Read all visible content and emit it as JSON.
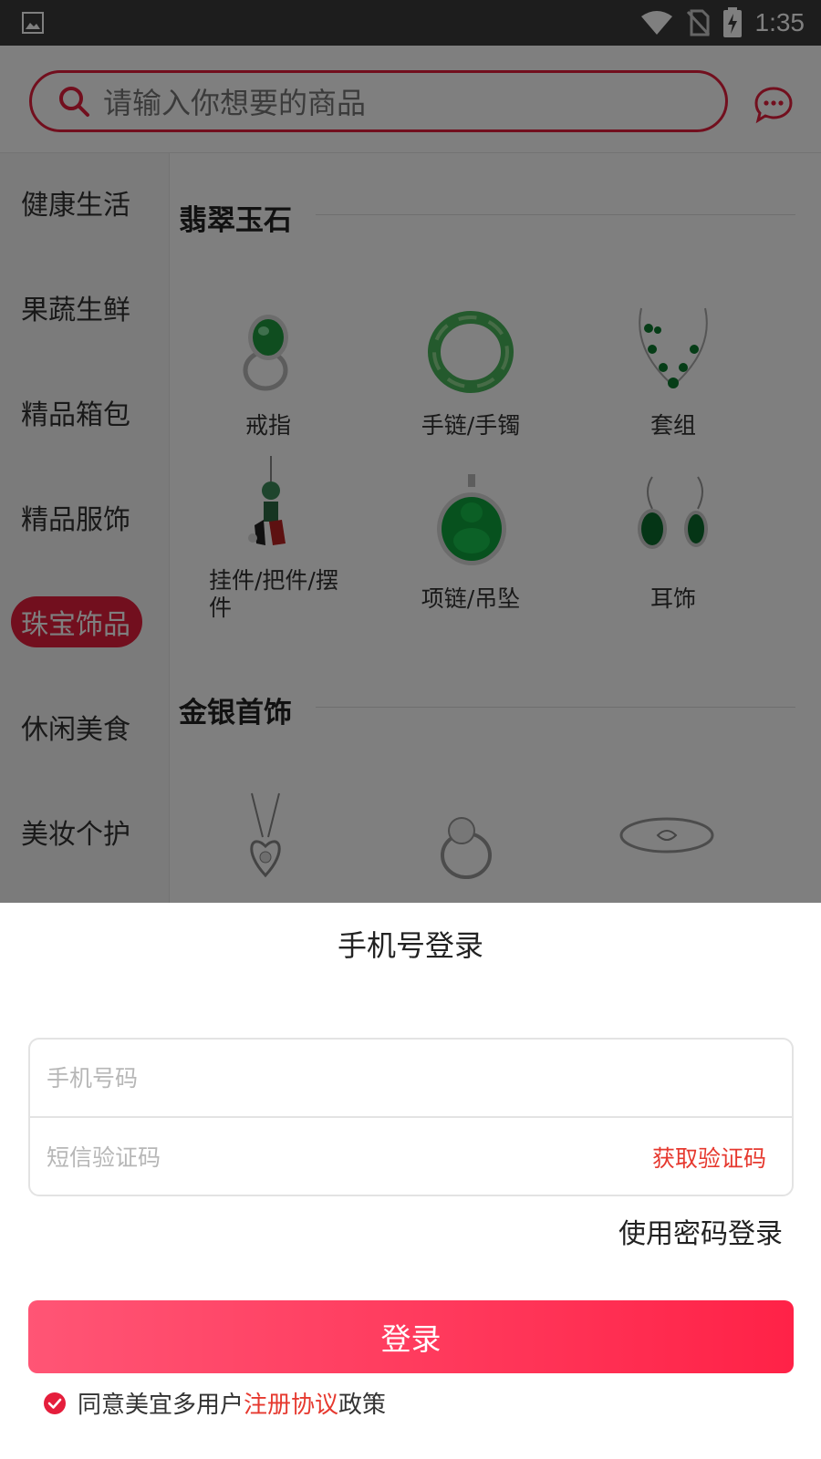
{
  "status_bar": {
    "time": "1:35",
    "icons": [
      "gallery-icon",
      "wifi-icon",
      "no-sim-icon",
      "battery-charging-icon"
    ]
  },
  "header": {
    "search_placeholder": "请输入你想要的商品",
    "message_icon": "chat-bubble-icon"
  },
  "sidebar": {
    "items": [
      {
        "label": "健康生活"
      },
      {
        "label": "果蔬生鲜"
      },
      {
        "label": "精品箱包"
      },
      {
        "label": "精品服饰"
      },
      {
        "label": "珠宝饰品",
        "active": true
      },
      {
        "label": "休闲美食"
      },
      {
        "label": "美妆个护"
      }
    ]
  },
  "content": {
    "sections": [
      {
        "title": "翡翠玉石",
        "products": [
          {
            "label": "戒指"
          },
          {
            "label": "手链/手镯"
          },
          {
            "label": "套组"
          },
          {
            "label": "挂件/把件/摆件"
          },
          {
            "label": "项链/吊坠"
          },
          {
            "label": "耳饰"
          }
        ]
      },
      {
        "title": "金银首饰",
        "products": []
      }
    ]
  },
  "login_sheet": {
    "title": "手机号登录",
    "phone_placeholder": "手机号码",
    "sms_placeholder": "短信验证码",
    "get_code": "获取验证码",
    "password_login": "使用密码登录",
    "login_button": "登录",
    "agree_prefix": "同意美宜多用户",
    "agree_link": "注册协议",
    "agree_suffix": "政策"
  },
  "colors": {
    "accent": "#e51e3c",
    "link": "#e6392f",
    "button_start": "#ff5575",
    "button_end": "#ff2247",
    "overlay": "rgba(0,0,0,0.5)"
  }
}
